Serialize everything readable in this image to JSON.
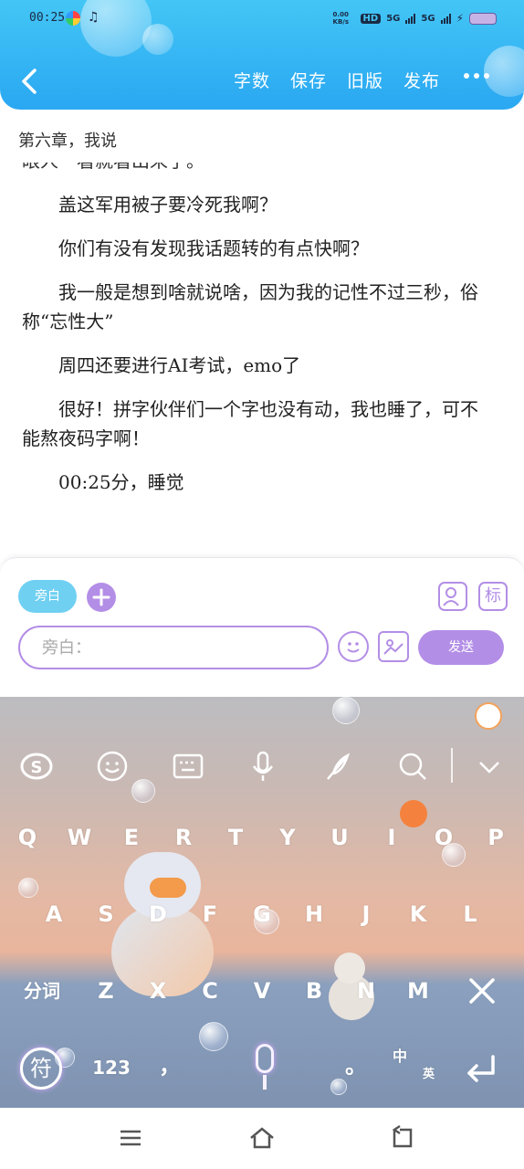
{
  "status_bar": {
    "time": "00:25",
    "network_speed": "0.00 KB/s",
    "hd_label": "HD",
    "sim1_label": "5G",
    "sim2_label": "5G"
  },
  "header": {
    "toolbar": {
      "word_count": "字数",
      "save": "保存",
      "old_version": "旧版",
      "publish": "发布"
    }
  },
  "chapter": {
    "title": "第六章，我说",
    "partial_line": "眼人一看就看出来了。",
    "paragraphs": [
      "盖这军用被子要冷死我啊？",
      "你们有没有发现我话题转的有点快啊？",
      "我一般是想到啥就说啥，因为我的记性不过三秒，俗称“忘性大”",
      "周四还要进行AI考试，emo了",
      "很好！拼字伙伴们一个字也没有动，我也睡了，可不能熬夜码字啊！",
      "00:25分，睡觉"
    ]
  },
  "input_panel": {
    "tag_label": "旁白",
    "input_placeholder": "旁白：",
    "send_label": "发送",
    "side_icon_label": "标"
  },
  "keyboard": {
    "row1": [
      "Q",
      "W",
      "E",
      "R",
      "T",
      "Y",
      "U",
      "I",
      "O",
      "P"
    ],
    "row2": [
      "A",
      "S",
      "D",
      "F",
      "G",
      "H",
      "J",
      "K",
      "L"
    ],
    "row3": [
      "Z",
      "X",
      "C",
      "V",
      "B",
      "N",
      "M"
    ],
    "fenci": "分词",
    "symbols": "符",
    "numbers": "123",
    "comma": "，",
    "period": "。",
    "lang_zh": "中",
    "lang_en": "英"
  },
  "icons": {
    "back": "chevron-left-icon",
    "more": "more-dots-icon",
    "sogou": "sogou-logo-icon",
    "emoji": "smile-icon",
    "keyboard": "keyboard-icon",
    "mic": "mic-icon",
    "handwrite": "feather-icon",
    "search": "search-icon",
    "collapse": "chevron-down-icon",
    "delete": "delete-icon",
    "enter": "enter-icon"
  },
  "colors": {
    "header_blue": "#2aa7f2",
    "accent_purple": "#b38ee6",
    "tag_blue": "#6fd0f2"
  }
}
